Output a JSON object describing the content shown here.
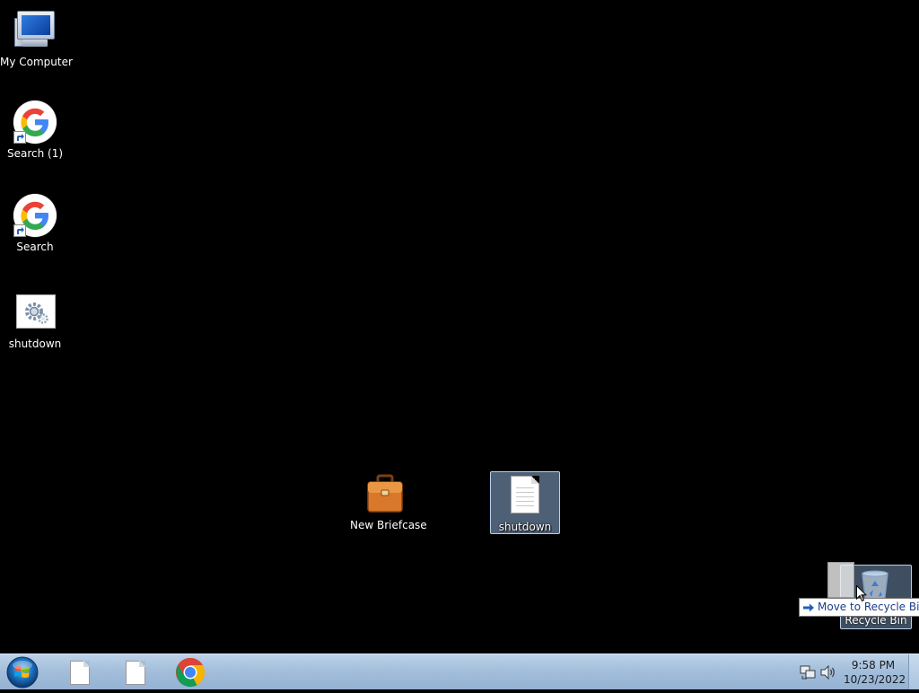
{
  "desktop": {
    "icons": [
      {
        "label": "My Computer",
        "icon": "computer-icon"
      },
      {
        "label": "Search (1)",
        "icon": "google-icon"
      },
      {
        "label": "Search",
        "icon": "google-icon"
      },
      {
        "label": "shutdown",
        "icon": "settings-file-icon"
      },
      {
        "label": "New Briefcase",
        "icon": "briefcase-icon"
      },
      {
        "label": "shutdown",
        "icon": "text-file-icon",
        "selected": true
      }
    ],
    "recycle_bin": {
      "label": "Recycle Bin",
      "icon": "recycle-bin-icon"
    },
    "drag_tooltip": "Move to Recycle Bin"
  },
  "taskbar": {
    "start": "windows-start-icon",
    "pinned": [
      "file-icon",
      "file-icon",
      "chrome-icon"
    ],
    "tray": {
      "time": "9:58 PM",
      "date": "10/23/2022"
    }
  },
  "colors": {
    "desktop_bg": "#000000",
    "taskbar": "#a4bfdc",
    "selection": "#8cafd7"
  }
}
